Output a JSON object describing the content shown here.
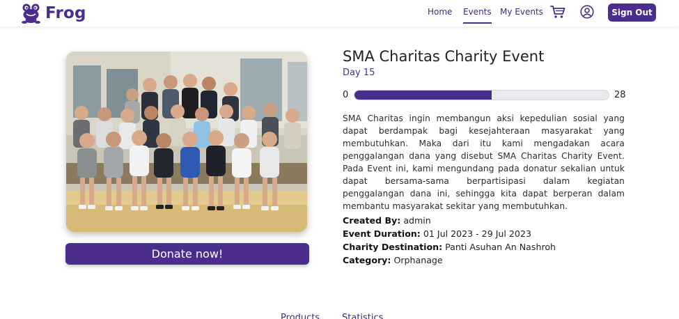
{
  "header": {
    "brand_name": "Frog",
    "nav": {
      "home": "Home",
      "events": "Events",
      "my_events": "My Events"
    },
    "icons": {
      "logo": "frog-logo-icon",
      "cart": "cart-icon",
      "user": "user-icon"
    },
    "sign_out": "Sign Out"
  },
  "event": {
    "title": "SMA Charitas Charity Event",
    "day": "Day 15",
    "progress": {
      "min_label": "0",
      "max_label": "28",
      "fraction": 0.54
    },
    "description": "SMA Charitas ingin membangun aksi kepedulian sosial yang dapat berdampak bagi kesejahteraan masyarakat yang membutuhkan. Maka dari itu kami mengadakan acara penggalangan dana yang disebut SMA Charitas Charity Event. Pada Event ini, kami mengundang pada donatur sekalian untuk dapat bersama-sama berpartisipasi dalam kegiatan penggalangan dana ini, sehingga kita dapat berperan dalam membantu masyarakat sekitar yang membutuhkan.",
    "created_by_label": "Created By:",
    "created_by": "admin",
    "duration_label": "Event Duration:",
    "duration": "01 Jul 2023 - 29 Jul 2023",
    "destination_label": "Charity Destination:",
    "destination": "Panti Asuhan An Nashroh",
    "category_label": "Category:",
    "category": "Orphanage"
  },
  "donate_label": "Donate now!",
  "tabs": {
    "products": "Products",
    "statistics": "Statistics"
  },
  "colors": {
    "primary": "#4a2d8c",
    "progress_track": "#e9e9ee"
  }
}
